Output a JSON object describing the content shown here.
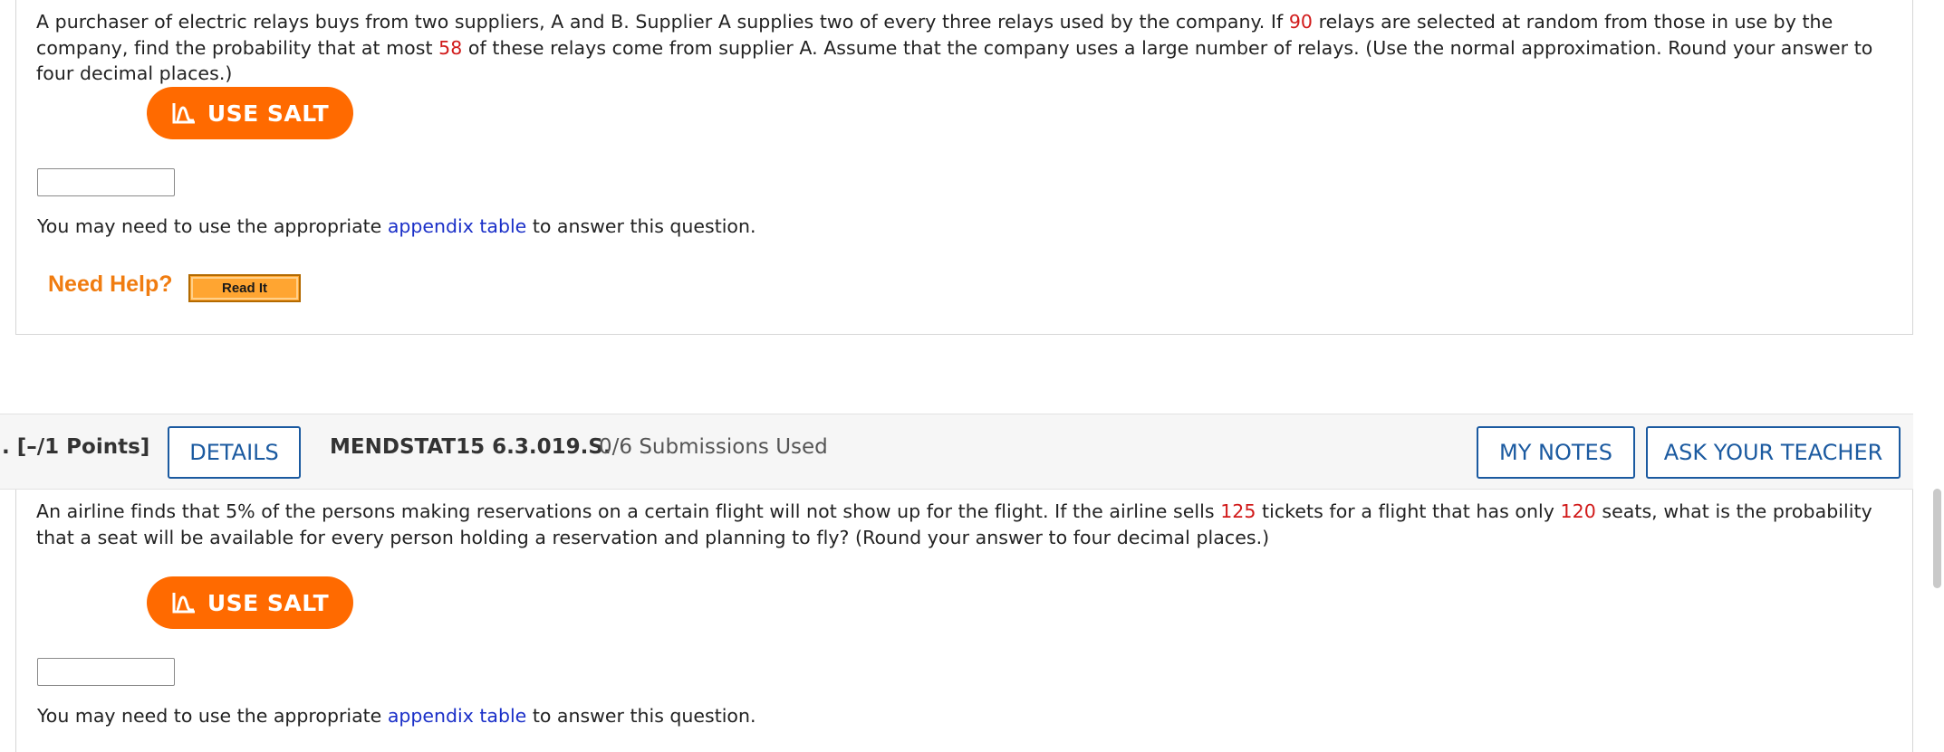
{
  "question1": {
    "text_parts": [
      "A purchaser of electric relays buys from two suppliers, A and B. Supplier A supplies two of every three relays used by the company. If ",
      "90",
      " relays are selected at random from those in use by the company, find the probability that at most ",
      "58",
      " of these relays come from supplier A. Assume that the company uses a large number of relays. (Use the normal approximation. Round your answer to four decimal places.)"
    ],
    "salt_label": "USE SALT",
    "answer_value": "",
    "note_before": "You may need to use the appropriate ",
    "note_link": "appendix table",
    "note_after": " to answer this question.",
    "need_help": "Need Help?",
    "read_it": "Read It"
  },
  "question2_header": {
    "points": ". [–/1 Points]",
    "details": "DETAILS",
    "problem_id": "MENDSTAT15 6.3.019.S.",
    "submissions": "0/6 Submissions Used",
    "my_notes": "MY NOTES",
    "ask_teacher": "ASK YOUR TEACHER"
  },
  "question2": {
    "text_parts": [
      "An airline finds that 5% of the persons making reservations on a certain flight will not show up for the flight. If the airline sells ",
      "125",
      " tickets for a flight that has only ",
      "120",
      " seats, what is the probability that a seat will be available for every person holding a reservation and planning to fly? (Round your answer to four decimal places.)"
    ],
    "salt_label": "USE SALT",
    "answer_value": "",
    "note_before": "You may need to use the appropriate ",
    "note_link": "appendix table",
    "note_after": " to answer this question."
  },
  "colors": {
    "salt_orange": "#ff6a00",
    "highlight_red": "#d11a1a",
    "link_blue": "#1a2fc8",
    "button_blue": "#1b5aa0",
    "help_orange": "#f07c10"
  },
  "icons": {
    "salt": "salt-chart-icon"
  }
}
